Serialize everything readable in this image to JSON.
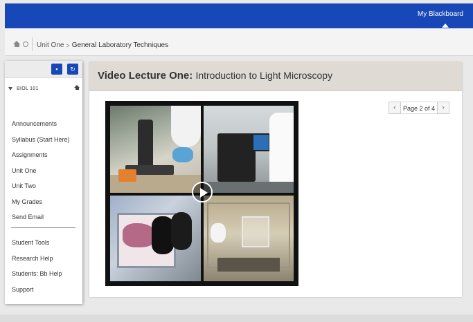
{
  "header": {
    "user_menu_label": "My Blackboard"
  },
  "breadcrumb": {
    "items": [
      "Unit One",
      "General Laboratory Techniques"
    ],
    "separator": ">"
  },
  "sidebar": {
    "course_name": "BIOL 101",
    "menu_primary": [
      "Announcements",
      "Syllabus (Start Here)",
      "Assignments",
      "Unit One",
      "Unit Two",
      "My Grades",
      "Send Email"
    ],
    "menu_secondary": [
      "Student Tools",
      "Research Help",
      "Students: Bb Help",
      "Support"
    ],
    "icons": [
      "folder-icon",
      "refresh-icon",
      "collapse-triangle-icon",
      "course-home-icon"
    ]
  },
  "content": {
    "title_bold": "Video Lecture One:",
    "title_normal": "Introduction to Light Microscopy",
    "pager": {
      "prev_symbol": "‹",
      "label": "Page 2 of 4",
      "next_symbol": "›"
    }
  },
  "colors": {
    "brand_blue": "#1848b8",
    "header_bg": "#dfdbd4",
    "page_bg": "#e9e9e9"
  }
}
